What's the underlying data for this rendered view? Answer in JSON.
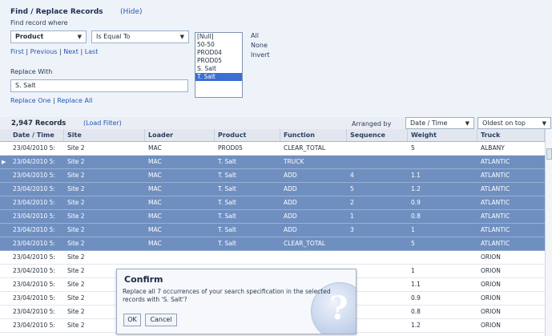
{
  "panel": {
    "title": "Find / Replace Records",
    "hide_label": "(Hide)",
    "find_label": "Find record where",
    "field_select": "Product",
    "operator_select": "Is Equal To",
    "nav": {
      "first": "First",
      "previous": "Previous",
      "next": "Next",
      "last": "Last",
      "sep": "|"
    },
    "replace_label": "Replace With",
    "replace_value": "S. Salt",
    "replace_one": "Replace One",
    "replace_all": "Replace All",
    "values_list": [
      "[Null]",
      "50-50",
      "PROD04",
      "PROD05",
      "S. Salt",
      "T. Salt"
    ],
    "selected_value": "T. Salt",
    "select_all": "All",
    "select_none": "None",
    "select_invert": "Invert"
  },
  "records_bar": {
    "count": "2,947 Records",
    "load_filter": "(Load Filter)",
    "arranged_by_label": "Arranged by",
    "arranged_by_value": "Date / Time",
    "order_value": "Oldest on top"
  },
  "grid": {
    "columns": [
      "Date / Time",
      "Site",
      "Loader",
      "Product",
      "Function",
      "Sequence",
      "Weight",
      "Truck"
    ],
    "rows": [
      {
        "cells": [
          "23/04/2010 5:",
          "Site 2",
          "MAC",
          "PROD05",
          "CLEAR_TOTAL",
          "",
          "5",
          "ALBANY"
        ],
        "highlight": false,
        "current": false
      },
      {
        "cells": [
          "23/04/2010 5:",
          "Site 2",
          "MAC",
          "T. Salt",
          "TRUCK",
          "",
          "",
          "ATLANTIC"
        ],
        "highlight": true,
        "current": true
      },
      {
        "cells": [
          "23/04/2010 5:",
          "Site 2",
          "MAC",
          "T. Salt",
          "ADD",
          "4",
          "1.1",
          "ATLANTIC"
        ],
        "highlight": true,
        "current": false
      },
      {
        "cells": [
          "23/04/2010 5:",
          "Site 2",
          "MAC",
          "T. Salt",
          "ADD",
          "5",
          "1.2",
          "ATLANTIC"
        ],
        "highlight": true,
        "current": false
      },
      {
        "cells": [
          "23/04/2010 5:",
          "Site 2",
          "MAC",
          "T. Salt",
          "ADD",
          "2",
          "0.9",
          "ATLANTIC"
        ],
        "highlight": true,
        "current": false
      },
      {
        "cells": [
          "23/04/2010 5:",
          "Site 2",
          "MAC",
          "T. Salt",
          "ADD",
          "1",
          "0.8",
          "ATLANTIC"
        ],
        "highlight": true,
        "current": false
      },
      {
        "cells": [
          "23/04/2010 5:",
          "Site 2",
          "MAC",
          "T. Salt",
          "ADD",
          "3",
          "1",
          "ATLANTIC"
        ],
        "highlight": true,
        "current": false
      },
      {
        "cells": [
          "23/04/2010 5:",
          "Site 2",
          "MAC",
          "T. Salt",
          "CLEAR_TOTAL",
          "",
          "5",
          "ATLANTIC"
        ],
        "highlight": true,
        "current": false
      },
      {
        "cells": [
          "23/04/2010 5:",
          "Site 2",
          "",
          "",
          "",
          "",
          "",
          "ORION"
        ],
        "highlight": false,
        "current": false
      },
      {
        "cells": [
          "23/04/2010 5:",
          "Site 2",
          "",
          "",
          "",
          "",
          "1",
          "ORION"
        ],
        "highlight": false,
        "current": false
      },
      {
        "cells": [
          "23/04/2010 5:",
          "Site 2",
          "",
          "",
          "",
          "",
          "1.1",
          "ORION"
        ],
        "highlight": false,
        "current": false
      },
      {
        "cells": [
          "23/04/2010 5:",
          "Site 2",
          "",
          "",
          "",
          "",
          "0.9",
          "ORION"
        ],
        "highlight": false,
        "current": false
      },
      {
        "cells": [
          "23/04/2010 5:",
          "Site 2",
          "",
          "",
          "",
          "",
          "0.8",
          "ORION"
        ],
        "highlight": false,
        "current": false
      },
      {
        "cells": [
          "23/04/2010 5:",
          "Site 2",
          "",
          "",
          "",
          "",
          "1.2",
          "ORION"
        ],
        "highlight": false,
        "current": false
      }
    ]
  },
  "confirm": {
    "title": "Confirm",
    "message": "Replace all 7 occurrences of your search specification in the selected records with 'S. Salt'?",
    "ok": "OK",
    "cancel": "Cancel",
    "icon": "question-icon"
  },
  "colors": {
    "highlight_row": "#6f8fc0",
    "link": "#2457b8",
    "panel_bg": "#eef3fa"
  }
}
